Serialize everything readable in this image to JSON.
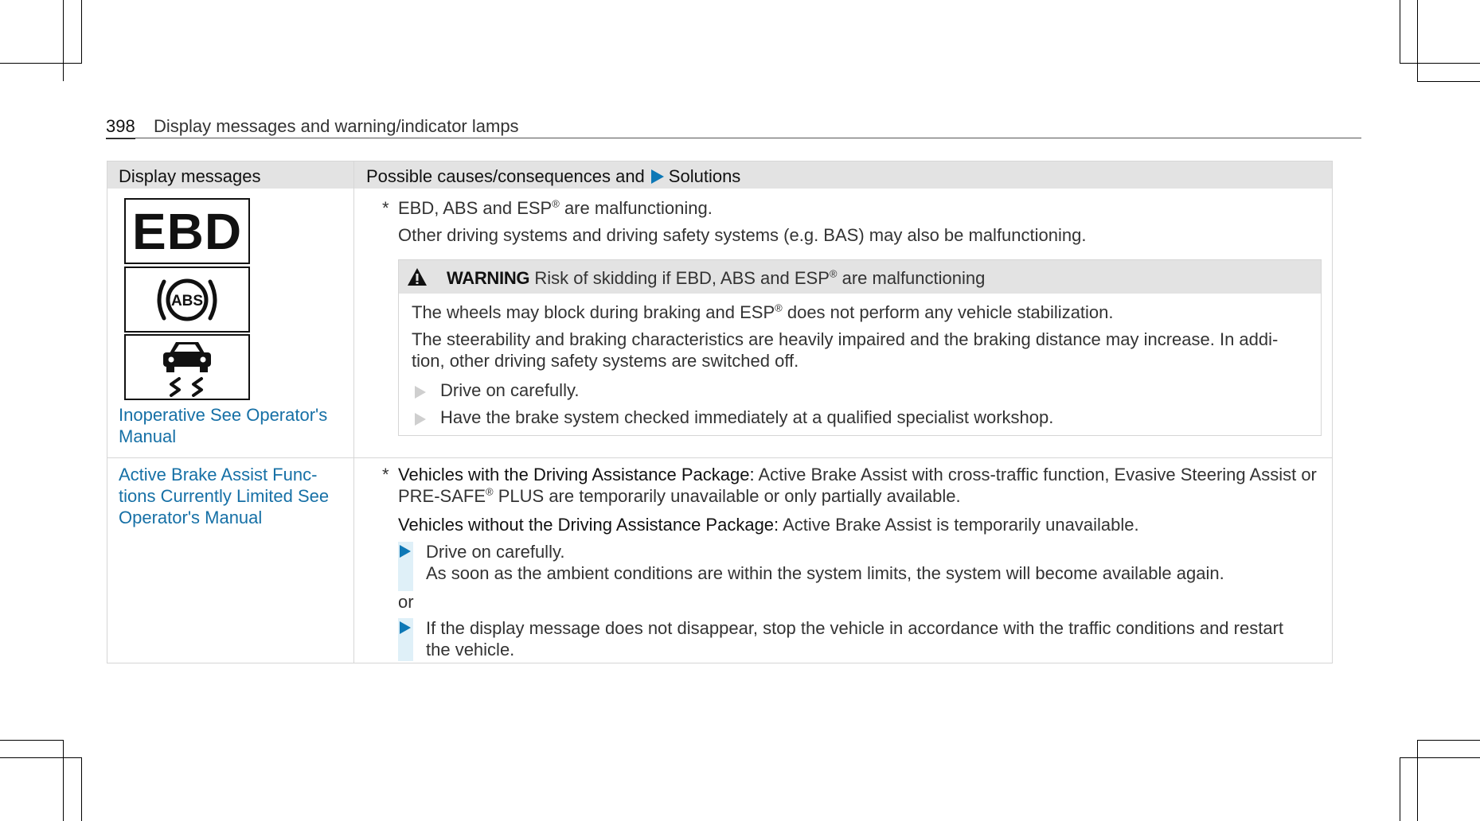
{
  "header": {
    "page_number": "398",
    "title": "Display messages and warning/indicator lamps"
  },
  "table": {
    "col1_header": "Display messages",
    "col2_header_causes": "Possible causes/consequences and",
    "col2_header_solutions": "Solutions",
    "row1": {
      "indicator_ebd_text": "EBD",
      "indicator_abs_text": "ABS",
      "message_line1": "Inoperative See Operator's",
      "message_line2": "Manual",
      "star": "*",
      "cause_line1": "EBD, ABS and ESP® are malfunctioning.",
      "cause_line2": "Other driving systems and driving safety systems (e.g. BAS) may also be malfunctioning.",
      "warning": {
        "label": "WARNING",
        "title": "Risk of skidding if EBD, ABS and ESP® are malfunctioning",
        "text1": "The wheels may block during braking and ESP® does not perform any vehicle stabilization.",
        "text2_line1": "The steerability and braking characteristics are heavily impaired and the braking distance may increase. In addi‐",
        "text2_line2": "tion, other driving safety systems are switched off.",
        "step1": "Drive on carefully.",
        "step2": "Have the brake system checked immediately at a qualified specialist workshop."
      }
    },
    "row2": {
      "message_line1": "Active Brake Assist Func‐",
      "message_line2": "tions Currently Limited See",
      "message_line3": "Operator's Manual",
      "star": "*",
      "with_label": "Vehicles with the Driving Assistance Package:",
      "with_text_line1": "Active Brake Assist with cross-traffic function, Evasive Steering Assist or",
      "with_text_line2": "PRE-SAFE® PLUS are temporarily unavailable or only partially available.",
      "without_label": "Vehicles without the Driving Assistance Package:",
      "without_text": "Active Brake Assist is temporarily unavailable.",
      "step1": "Drive on carefully.",
      "step1_result": "As soon as the ambient conditions are within the system limits, the system will become available again.",
      "or": "or",
      "step2_line1": "If the display message does not disappear, stop the vehicle in accordance with the traffic conditions and restart",
      "step2_line2": "the vehicle."
    }
  },
  "colors": {
    "link_blue": "#1670a6",
    "accent_blue": "#0d78b6",
    "header_grey": "#e3e3e3",
    "step_bar_blue": "#dff0f8"
  },
  "icons": [
    "warning-triangle-icon",
    "abs-icon",
    "skidding-car-icon",
    "step-arrow-icon"
  ]
}
